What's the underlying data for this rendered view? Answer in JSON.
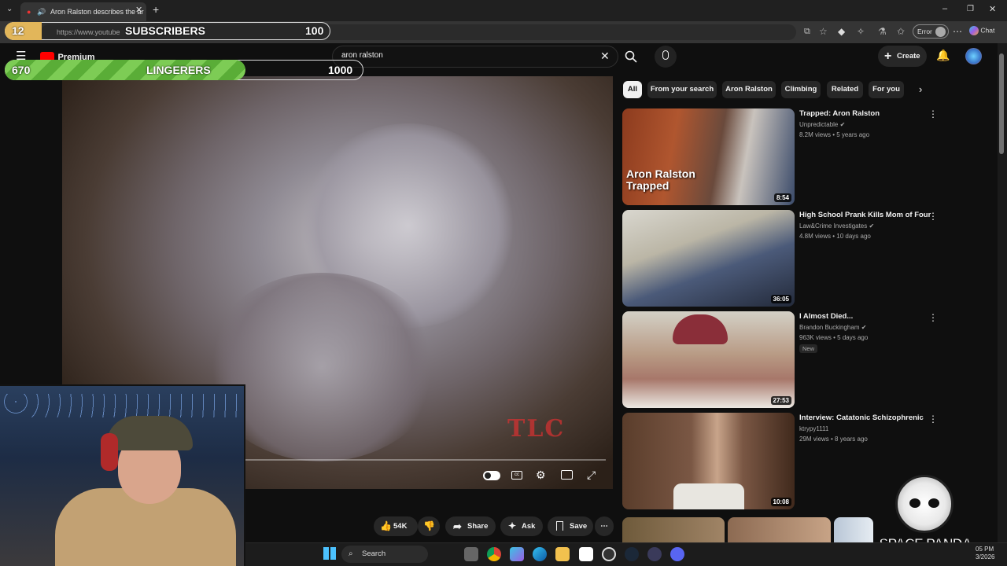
{
  "browser": {
    "tab_title": "Aron Ralston describes the ar",
    "url": "https://www.youtube",
    "error_label": "Error",
    "chat_label": "Chat"
  },
  "youtube": {
    "logo_text": "Premium",
    "search_query": "aron ralston",
    "create_label": "Create",
    "chips": [
      "All",
      "From your search",
      "Aron Ralston",
      "Climbing",
      "Related",
      "For you"
    ],
    "actions": {
      "likes": "54K",
      "share": "Share",
      "ask": "Ask",
      "save": "Save"
    },
    "recommendations": [
      {
        "title": "Trapped: Aron Ralston",
        "channel": "Unpredictable",
        "meta": "8.2M views • 5 years ago",
        "duration": "8:54",
        "thumb_caption": "Aron Ralston Trapped"
      },
      {
        "title": "High School Prank Kills Mom of Four",
        "channel": "Law&Crime Investigates",
        "meta": "4.8M views • 10 days ago",
        "duration": "36:05"
      },
      {
        "title": "I Almost Died...",
        "channel": "Brandon Buckingham",
        "meta": "963K views • 5 days ago",
        "badge": "New",
        "duration": "27:53"
      },
      {
        "title": "Interview: Catatonic Schizophrenic",
        "channel": "ktrypy1111",
        "meta": "29M views • 8 years ago",
        "duration": "10:08"
      }
    ],
    "video_watermark": "TLC"
  },
  "overlays": {
    "subscribers": {
      "current": "12",
      "label": "SUBSCRIBERS",
      "goal": "100",
      "progress": 0.12,
      "color": "#e2b65a"
    },
    "lingerers": {
      "current": "670",
      "label": "LINGERERS",
      "goal": "1000",
      "progress": 0.67,
      "color": "#6dbf45"
    },
    "logo_text": "SPACE PANDA"
  },
  "taskbar": {
    "search_label": "Search",
    "time": "05 PM",
    "date": "3/2026"
  }
}
